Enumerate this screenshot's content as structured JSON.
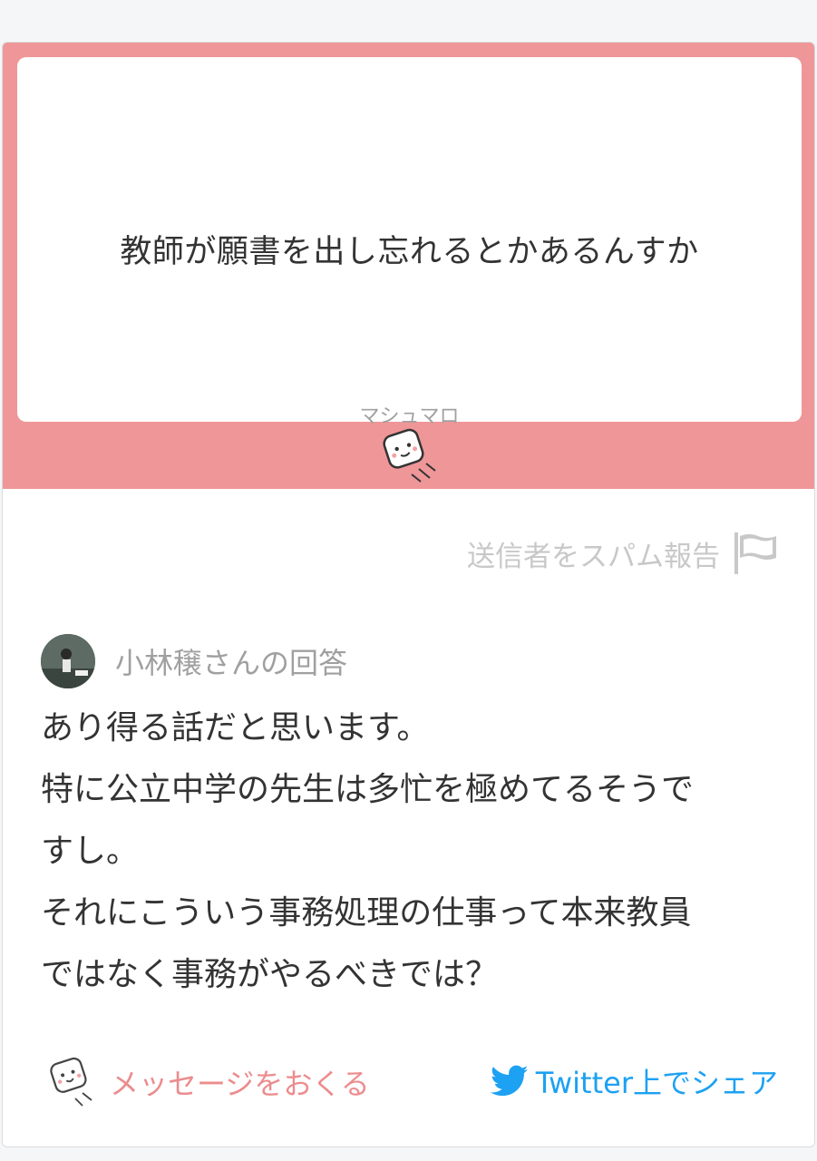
{
  "question": {
    "text": "教師が願書を出し忘れるとかあるんすか",
    "brand": "マシュマロ"
  },
  "spam_report": {
    "label": "送信者をスパム報告",
    "icon": "flag-icon"
  },
  "answer": {
    "by": "小林穣さんの回答",
    "lines": [
      "あり得る話だと思います。",
      "特に公立中学の先生は多忙を極めてるそうで",
      "すし。",
      "それにこういう事務処理の仕事って本来教員",
      "ではなく事務がやるべきでは？"
    ]
  },
  "footer": {
    "send_label": "メッセージをおくる",
    "share_label": "Twitter上でシェア"
  },
  "colors": {
    "pink_band": "#ef9698",
    "link_pink": "#ec8c8e",
    "twitter_blue": "#1da1f2",
    "muted_text": "#a0a0a0"
  }
}
